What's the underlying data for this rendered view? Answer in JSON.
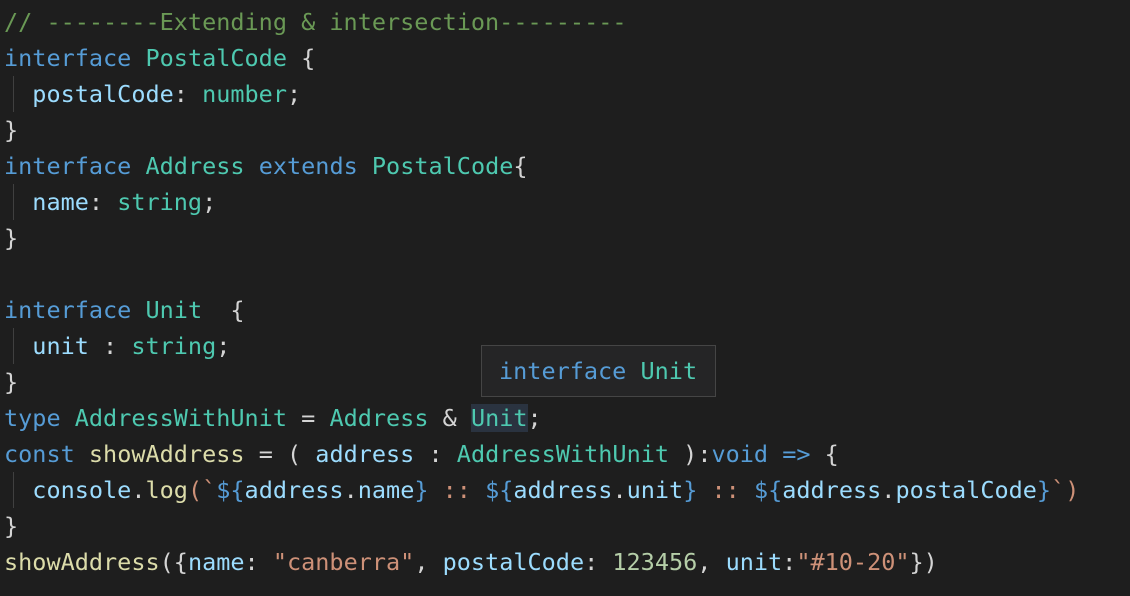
{
  "code": {
    "l1": {
      "comment": "// --------Extending & intersection---------"
    },
    "l2": {
      "kw": "interface",
      "name": "PostalCode",
      "brace": " {"
    },
    "l3": {
      "prop": "postalCode",
      "colon": ": ",
      "type": "number",
      "semi": ";"
    },
    "l4": {
      "brace": "}"
    },
    "l5": {
      "kw": "interface",
      "name": "Address",
      "kw2": "extends",
      "base": "PostalCode",
      "brace": "{"
    },
    "l6": {
      "prop": "name",
      "colon": ": ",
      "type": "string",
      "semi": ";"
    },
    "l7": {
      "brace": "}"
    },
    "l9": {
      "kw": "interface",
      "name": "Unit",
      "brace": "  {"
    },
    "l10": {
      "prop": "unit",
      "colon": " : ",
      "type": "string",
      "semi": ";"
    },
    "l11": {
      "brace": "}"
    },
    "l12": {
      "kw": "type",
      "name": "AddressWithUnit",
      "eq": " = ",
      "t1": "Address",
      "amp": " & ",
      "t2": "Unit",
      "semi": ";"
    },
    "l13": {
      "kw": "const",
      "fn": "showAddress",
      "eq": " = ( ",
      "param": "address",
      "colon": " : ",
      "ptype": "AddressWithUnit",
      "close": " ):",
      "ret": "void",
      "arrow": "=>",
      "brace": " {"
    },
    "l14": {
      "obj": "console",
      "dot": ".",
      "method": "log",
      "open": "(`",
      "d1o": "${",
      "p1": "address",
      "p1dot": ".",
      "p1prop": "name",
      "d1c": "}",
      "sep1": " :: ",
      "d2o": "${",
      "p2": "address",
      "p2dot": ".",
      "p2prop": "unit",
      "d2c": "}",
      "sep2": " :: ",
      "d3o": "${",
      "p3": "address",
      "p3dot": ".",
      "p3prop": "postalCode",
      "d3c": "}",
      "close": "`)"
    },
    "l15": {
      "brace": "}"
    },
    "l16": {
      "fn": "showAddress",
      "open": "({",
      "k1": "name",
      "c1": ": ",
      "v1": "\"canberra\"",
      "s1": ", ",
      "k2": "postalCode",
      "c2": ": ",
      "v2": "123456",
      "s2": ", ",
      "k3": "unit",
      "c3": ":",
      "v3": "\"#10-20\"",
      "close": "})"
    }
  },
  "hover": {
    "kw": "interface",
    "name": "Unit"
  },
  "colors": {
    "background": "#1e1e1e",
    "comment": "#6a9955",
    "keyword": "#569cd6",
    "type": "#4ec9b0",
    "property": "#9cdcfe",
    "function": "#dcdcaa",
    "string": "#ce9178",
    "number": "#b5cea8"
  }
}
